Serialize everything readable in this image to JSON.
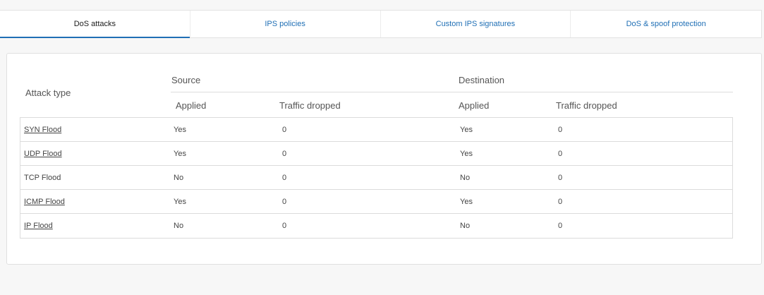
{
  "tabs": [
    {
      "label": "DoS attacks",
      "active": true
    },
    {
      "label": "IPS policies",
      "active": false
    },
    {
      "label": "Custom IPS signatures",
      "active": false
    },
    {
      "label": "DoS & spoof protection",
      "active": false
    }
  ],
  "table": {
    "attack_header": "Attack type",
    "source_header": "Source",
    "destination_header": "Destination",
    "applied_label": "Applied",
    "traffic_dropped_label": "Traffic dropped",
    "rows": [
      {
        "attack": "SYN Flood",
        "link": true,
        "src_applied": "Yes",
        "src_dropped": "0",
        "dst_applied": "Yes",
        "dst_dropped": "0"
      },
      {
        "attack": "UDP Flood",
        "link": true,
        "src_applied": "Yes",
        "src_dropped": "0",
        "dst_applied": "Yes",
        "dst_dropped": "0"
      },
      {
        "attack": "TCP Flood",
        "link": false,
        "src_applied": "No",
        "src_dropped": "0",
        "dst_applied": "No",
        "dst_dropped": "0"
      },
      {
        "attack": "ICMP Flood",
        "link": true,
        "src_applied": "Yes",
        "src_dropped": "0",
        "dst_applied": "Yes",
        "dst_dropped": "0"
      },
      {
        "attack": "IP Flood",
        "link": true,
        "src_applied": "No",
        "src_dropped": "0",
        "dst_applied": "No",
        "dst_dropped": "0"
      }
    ]
  },
  "colors": {
    "accent": "#1f6fb5"
  }
}
